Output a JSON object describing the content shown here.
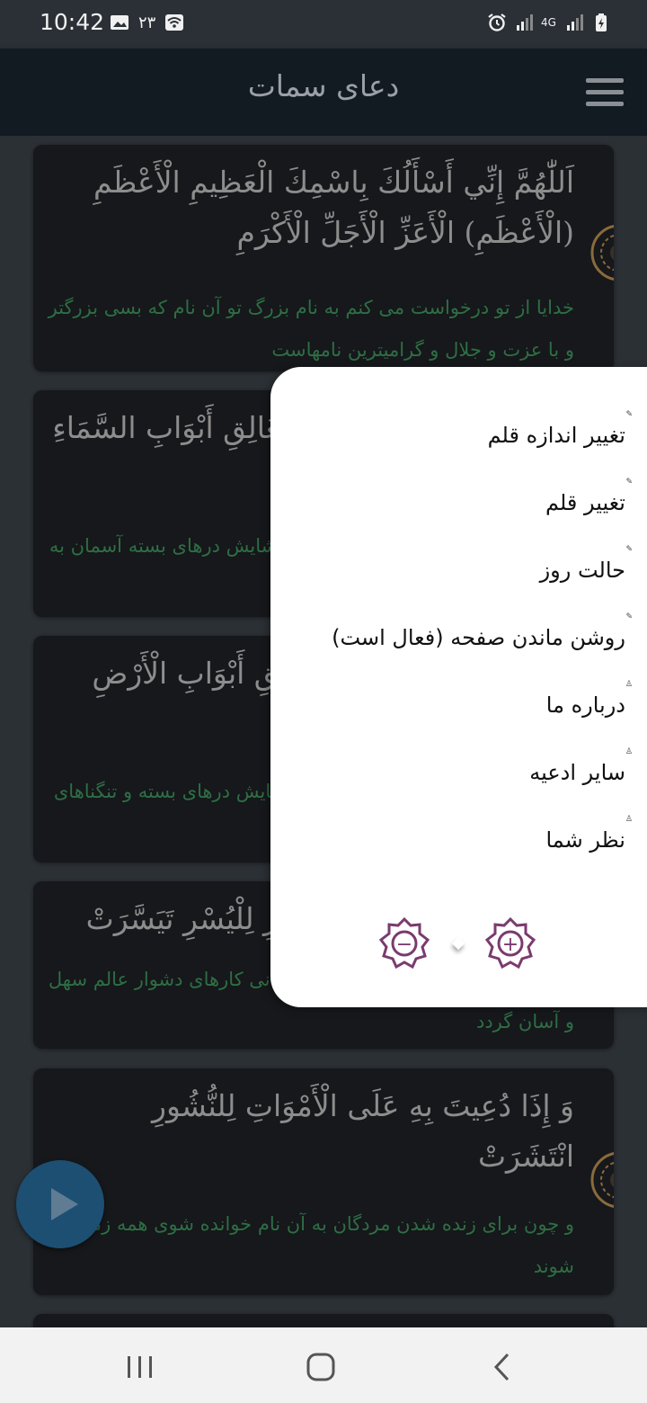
{
  "status_bar": {
    "time": "10:42",
    "extra": "۲۳",
    "network": "4G",
    "icons": [
      "image-icon",
      "wifi-icon",
      "alarm-icon",
      "signal-icon",
      "battery-icon"
    ]
  },
  "header": {
    "title": "دعای سمات",
    "menu_icon": "hamburger-icon"
  },
  "cards": [
    {
      "arabic": "اَللّٰهُمَّ إِنِّي أَسْأَلُكَ بِاسْمِكَ الْعَظِيمِ الْأَعْظَمِ (الْأَعْظَمِ) الْأَعَزِّ الْأَجَلِّ الْأَكْرَمِ",
      "persian": "خدایا از تو درخواست می کنم به نام بزرگ تو آن نام که بسی بزرگتر و با عزت و جلال و گرامیترین نامهاست"
    },
    {
      "arabic": "الَّذِي إِذَا دُعِيتَ بِهِ عَلَى مَغَالِقِ أَبْوَابِ السَّمَاءِ لِلْفَتْحِ بِالرَّحْمَةِ انْفَتَحَتْ",
      "persian": "که چون به آن نام خوانده شوی برای گشایش درهای بسته آسمان به رحمت و برکت گشوده گردد"
    },
    {
      "arabic": "وَ إِذَا دُعِيتَ بِهِ عَلَى مَضَائِقِ أَبْوَابِ الْأَرْضِ لِلْفَرَجِ انْفَرَجَتْ",
      "persian": "و چون به آن نام خوانده شوی برای گشایش درهای بسته و تنگناهای حوادث روی زمین گشایش گردد"
    },
    {
      "arabic": "وَ إِذَا دُعِيتَ بِهِ عَلَى الْعُسْرِ لِلْيُسْرِ تَيَسَّرَتْ",
      "persian": "و چون به آن نام خوانده شوی برای آسانی کارهای دشوار عالم سهل و آسان گردد"
    },
    {
      "arabic": "وَ إِذَا دُعِيتَ بِهِ عَلَى الْأَمْوَاتِ لِلنُّشُورِ انْتَشَرَتْ",
      "persian": "و چون برای زنده شدن مردگان به آن نام خوانده شوی همه زنده شوند"
    }
  ],
  "popup_menu": {
    "items": [
      {
        "label": "تغییر اندازه قلم",
        "icon": "pen-icon"
      },
      {
        "label": "تغییر قلم",
        "icon": "pen-icon"
      },
      {
        "label": "حالت روز",
        "icon": "pen-icon"
      },
      {
        "label": "روشن ماندن صفحه (فعال است)",
        "icon": "pen-icon"
      },
      {
        "label": "درباره ما",
        "icon": "person-icon"
      },
      {
        "label": "سایر ادعیه",
        "icon": "person-icon"
      },
      {
        "label": "نظر شما",
        "icon": "person-icon"
      }
    ],
    "font_buttons": {
      "decrease": "−",
      "increase": "+"
    },
    "accent_color": "#7a3b6e"
  },
  "play_button": {
    "icon": "play-icon",
    "color": "#1d4f73"
  },
  "nav_bar": {
    "icons": [
      "recents-icon",
      "home-icon",
      "back-icon"
    ]
  }
}
